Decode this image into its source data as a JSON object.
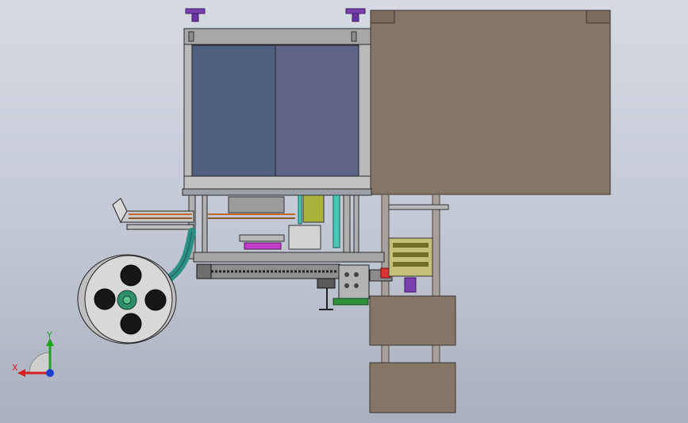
{
  "triad": {
    "x_label": "X",
    "y_label": "Y",
    "x_color": "#d42020",
    "y_color": "#1aa51a",
    "z_color": "#1f3fd0"
  },
  "colors": {
    "housing": "#857566",
    "housing_edge": "#3b3431",
    "window_left": "#4e5f80",
    "window_right": "#5f6385",
    "frame": "#b9b9b9",
    "frame_edge": "#2a2a2a",
    "teal": "#2c8f86",
    "purple_knob": "#7b3fb0",
    "reel": "#d8d8d8",
    "reel_hole": "#161616",
    "rod": "#a8a09a"
  }
}
